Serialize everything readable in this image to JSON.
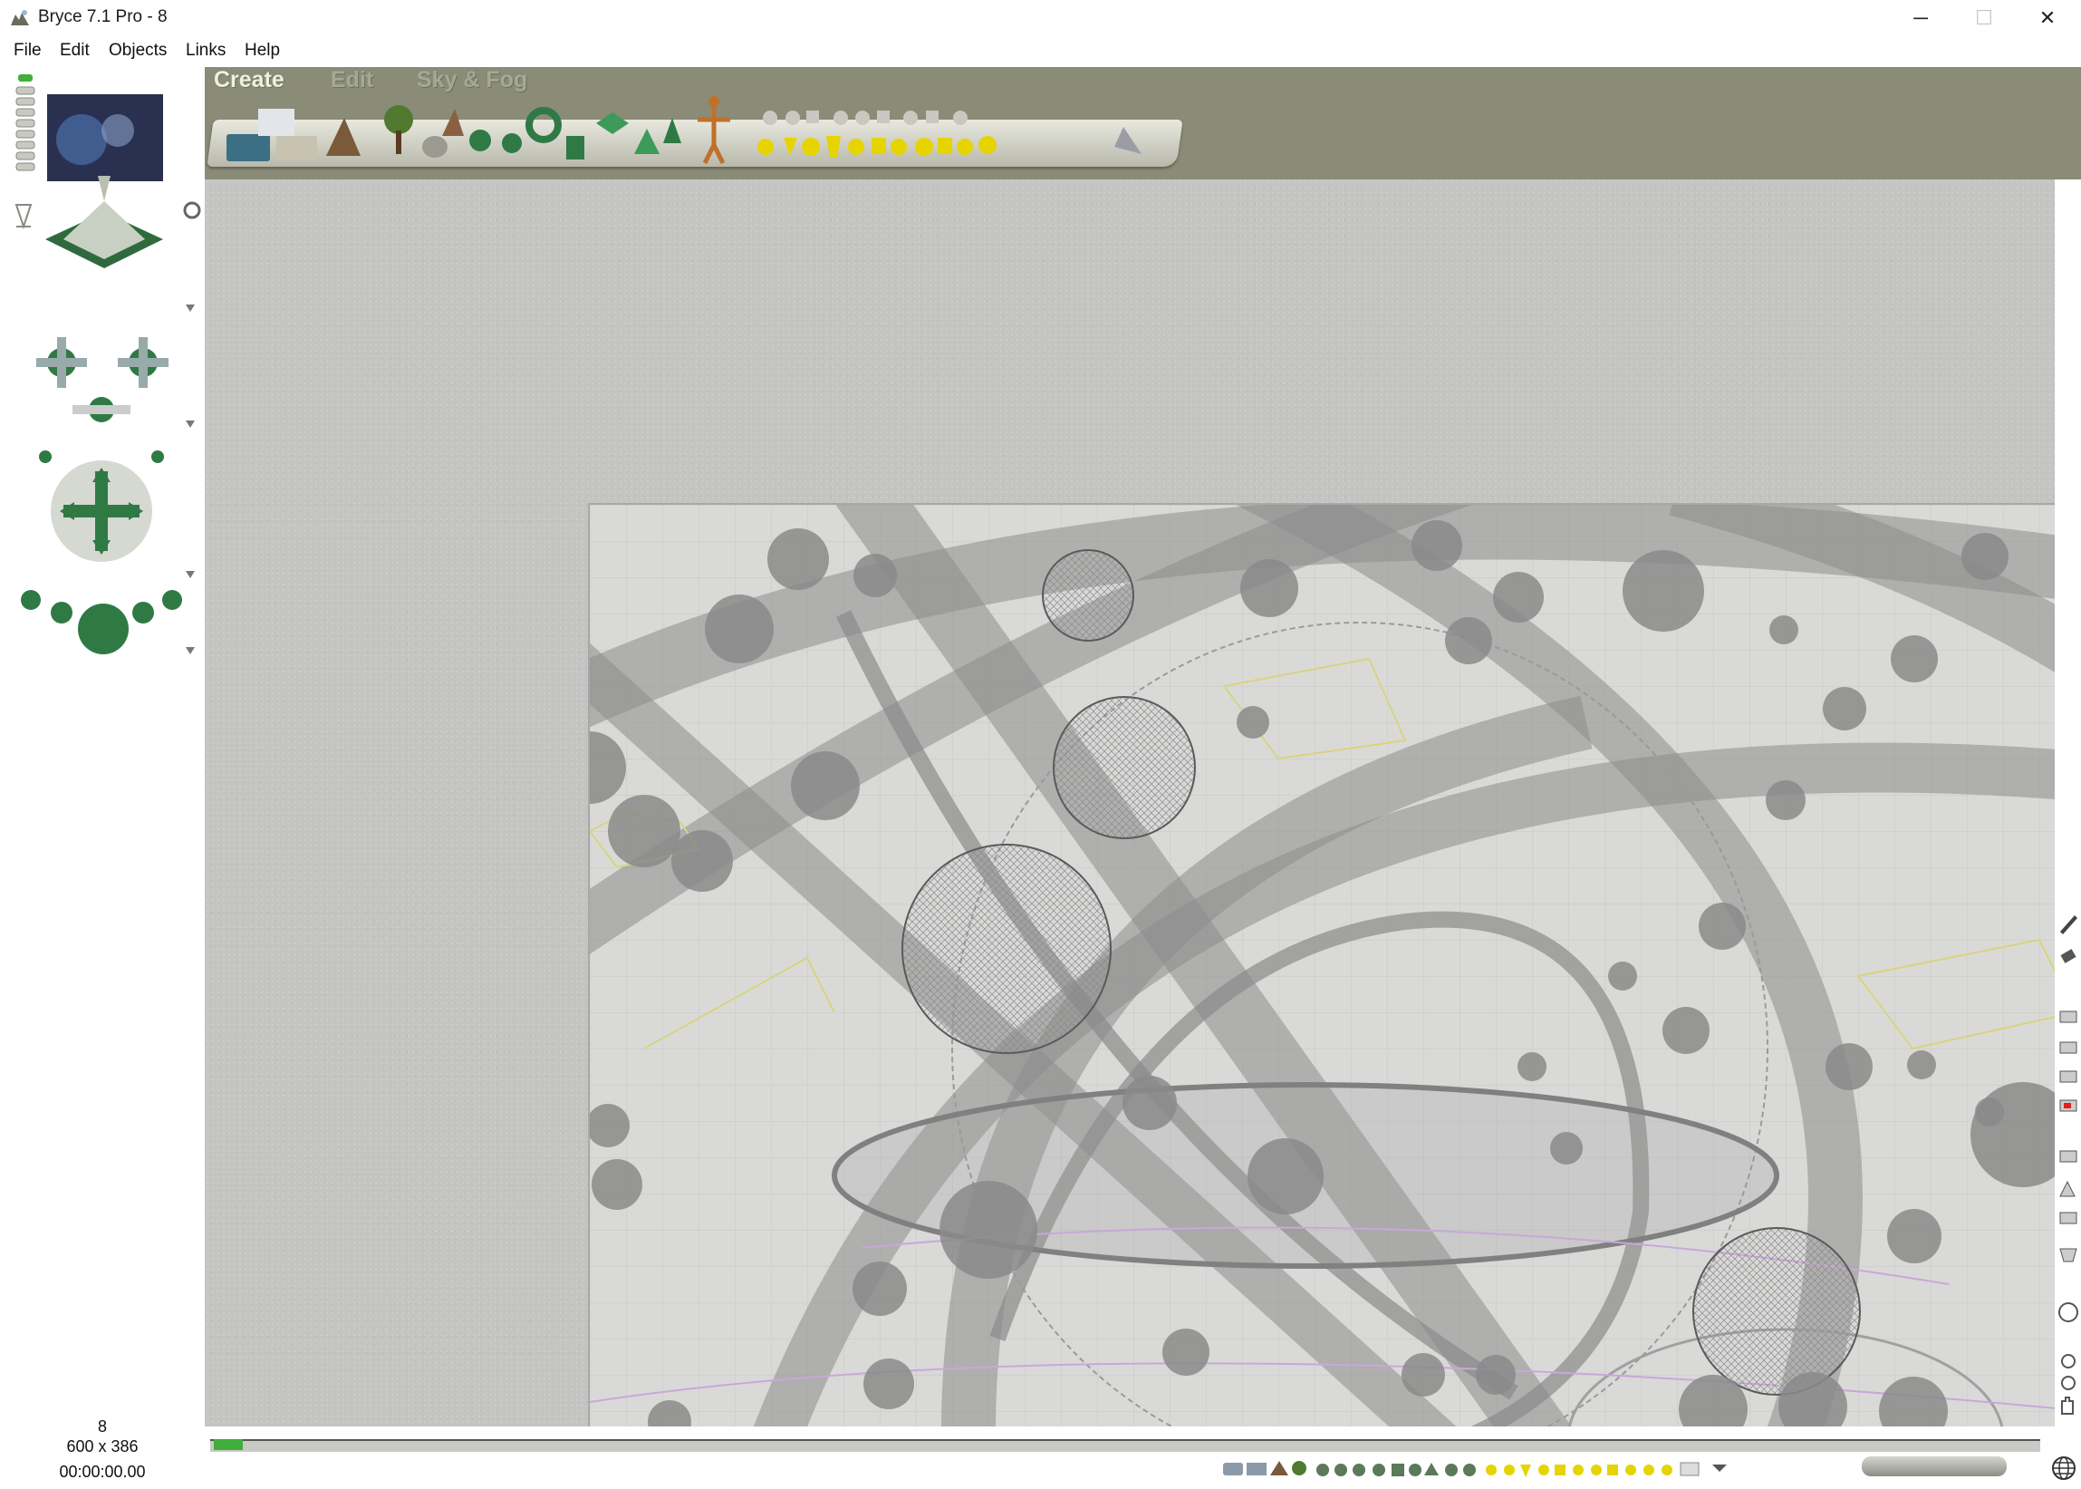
{
  "window": {
    "title": "Bryce 7.1  Pro - 8",
    "controls": {
      "minimize": "─",
      "maximize": "☐",
      "close": "✕"
    }
  },
  "menu": {
    "items": [
      "File",
      "Edit",
      "Objects",
      "Links",
      "Help"
    ]
  },
  "palette_tabs": {
    "create": "Create",
    "edit": "Edit",
    "sky_fog": "Sky & Fog"
  },
  "status": {
    "scene_number": "8",
    "document_size": "600 x 386",
    "timecode": "00:00:00.00"
  },
  "colors": {
    "chrome_olive": "#8a8c78",
    "workspace_gray": "#c4c4c2",
    "viewport_bg": "#d9dad8",
    "wire_gray": "#7a7a7a",
    "accent_green": "#2f7a44",
    "object_yellow": "#e6d400"
  },
  "icons": {
    "app": "bryce-app-icon",
    "left_panel": [
      "nano-preview-icon",
      "view-control-icon",
      "trackball-icon",
      "camera-cross-icon",
      "camera-sphere-icon"
    ],
    "right_strip": [
      "paint-brush-icon",
      "eraser-icon",
      "render-icon",
      "record-icon",
      "texture-icon",
      "zoom-in-icon",
      "zoom-out-icon",
      "hand-pan-icon"
    ],
    "bottom": [
      "mini-palette-icon",
      "playback-icon",
      "globe-icon"
    ]
  }
}
